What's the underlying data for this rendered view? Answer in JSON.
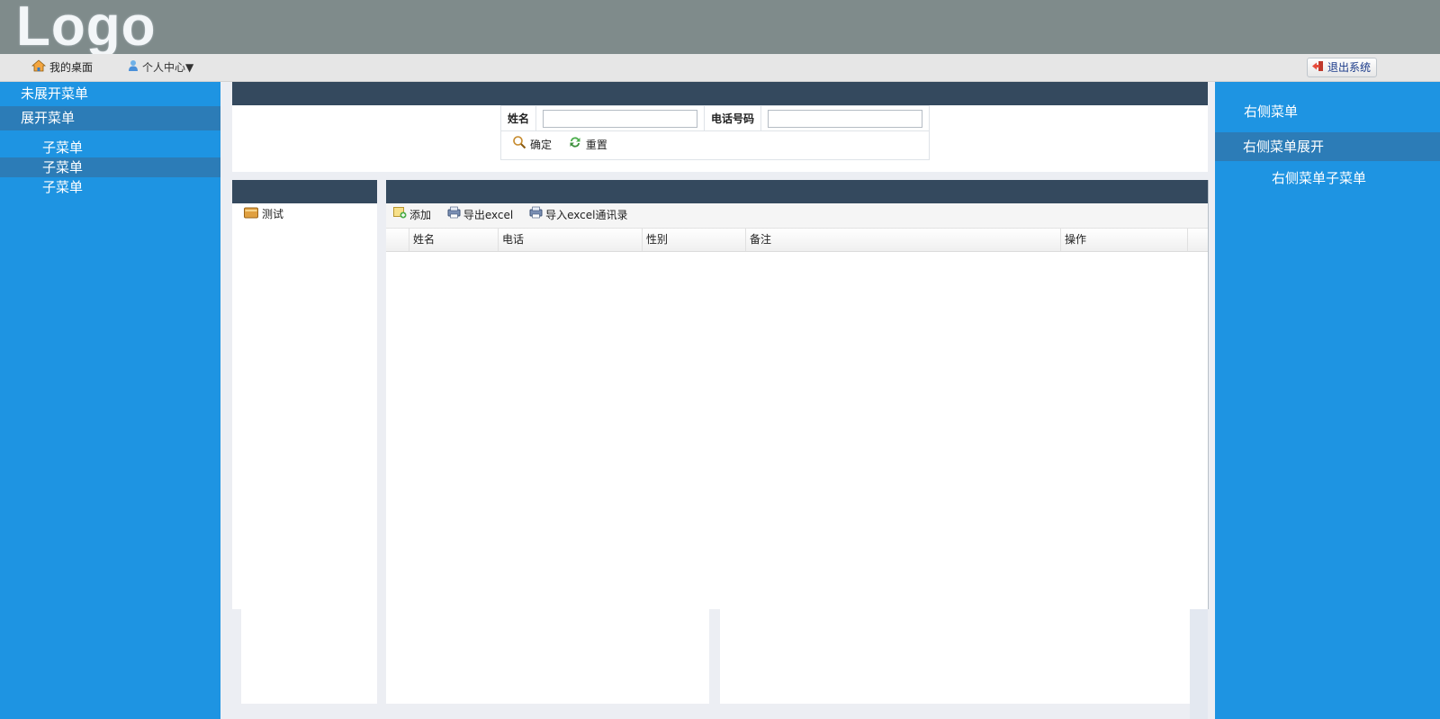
{
  "header": {
    "logo_text": "Logo"
  },
  "navbar": {
    "desk_label": "我的桌面",
    "personal_label": "个人中心▼",
    "logout_label": "退出系统"
  },
  "left_menu": {
    "collapsed_item": "未展开菜单",
    "expanded_item": "展开菜单",
    "sub_items": [
      "子菜单",
      "子菜单",
      "子菜单"
    ]
  },
  "right_menu": {
    "item": "右侧菜单",
    "expanded_item": "右侧菜单展开",
    "sub_item": "右侧菜单子菜单"
  },
  "search": {
    "name_label": "姓名",
    "name_value": "",
    "phone_label": "电话号码",
    "phone_value": "",
    "confirm_label": "确定",
    "reset_label": "重置"
  },
  "tree": {
    "node_label": "测试"
  },
  "toolbar": {
    "add_label": "添加",
    "export_label": "导出excel",
    "import_label": "导入excel通讯录"
  },
  "grid": {
    "columns": [
      "姓名",
      "电话",
      "性别",
      "备注",
      "操作"
    ]
  },
  "colors": {
    "header_bg": "#7f8b8b",
    "menu_bg": "#1e94e2",
    "menu_active": "#2c7cb7",
    "panel_head": "#34495e"
  }
}
